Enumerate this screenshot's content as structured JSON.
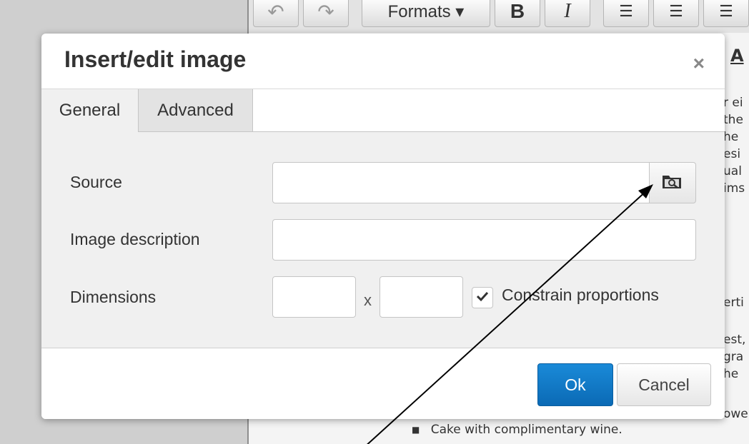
{
  "toolbar": {
    "formats_label": "Formats ▾",
    "bold_label": "B",
    "italic_label": "I",
    "a_label": "A"
  },
  "editor": {
    "edge_lines": [
      "r ei",
      "the",
      "he",
      "esi",
      "ual",
      "ims",
      "erti",
      "est,",
      "gra",
      "he",
      "owe"
    ],
    "bullet_text": "Cake with complimentary wine."
  },
  "dialog": {
    "title": "Insert/edit image",
    "close_glyph": "×",
    "tabs": [
      {
        "label": "General",
        "active": true
      },
      {
        "label": "Advanced",
        "active": false
      }
    ],
    "fields": {
      "source_label": "Source",
      "source_value": "",
      "description_label": "Image description",
      "description_value": "",
      "dimensions_label": "Dimensions",
      "width_value": "",
      "height_value": "",
      "times_sign": "x",
      "constrain_label": "Constrain proportions",
      "constrain_checked": true
    },
    "buttons": {
      "ok": "Ok",
      "cancel": "Cancel"
    }
  },
  "colors": {
    "primary_button": "#0b6ab5",
    "dialog_body": "#f0f0f0",
    "annotation_arrow": "#000000"
  },
  "icons": {
    "browse": "folder-search-icon",
    "close": "close-icon",
    "check": "checkmark-icon"
  }
}
